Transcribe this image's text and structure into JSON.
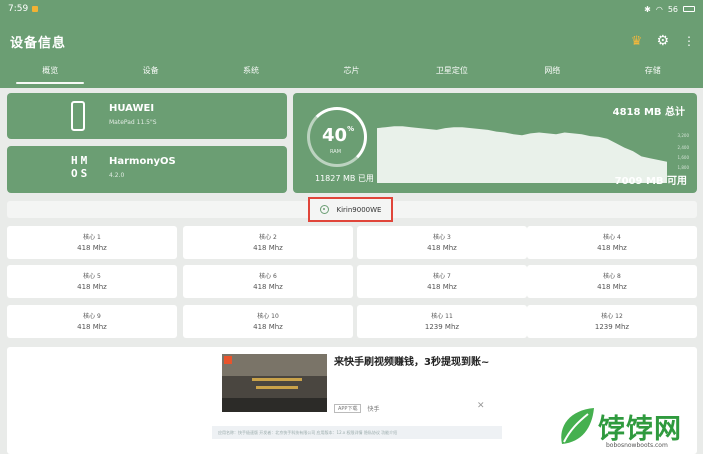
{
  "status_bar": {
    "time": "7:59",
    "right_text": "56"
  },
  "header": {
    "title": "设备信息"
  },
  "tabs": [
    {
      "label": "概览",
      "active": true
    },
    {
      "label": "设备",
      "active": false
    },
    {
      "label": "系统",
      "active": false
    },
    {
      "label": "芯片",
      "active": false
    },
    {
      "label": "卫星定位",
      "active": false
    },
    {
      "label": "网络",
      "active": false
    },
    {
      "label": "存储",
      "active": false
    }
  ],
  "device": {
    "brand": "HUAWEI",
    "model": "MatePad 11.5\"S"
  },
  "os": {
    "logo": "HM OS",
    "name": "HarmonyOS",
    "version": "4.2.0"
  },
  "ram": {
    "percent": "40",
    "percent_unit": "%",
    "label": "RAM",
    "used": "11827 MB 已用",
    "total": "4818 MB 总计",
    "free": "7009 MB 可用",
    "ticks": [
      "3,200",
      "2,400",
      "1,600",
      "1,800"
    ],
    "series": [
      62,
      63,
      64,
      64,
      63,
      62,
      61,
      60,
      62,
      63,
      63,
      62,
      61,
      60,
      58,
      57,
      55,
      54,
      56,
      57,
      56,
      55,
      57,
      56,
      55,
      53,
      52,
      50,
      45,
      40,
      36,
      30,
      28,
      26,
      24
    ]
  },
  "chip": {
    "name": "Kirin9000WE"
  },
  "cores": [
    {
      "name": "核心 1",
      "freq": "418 Mhz"
    },
    {
      "name": "核心 2",
      "freq": "418 Mhz"
    },
    {
      "name": "核心 3",
      "freq": "418 Mhz"
    },
    {
      "name": "核心 4",
      "freq": "418 Mhz"
    },
    {
      "name": "核心 5",
      "freq": "418 Mhz"
    },
    {
      "name": "核心 6",
      "freq": "418 Mhz"
    },
    {
      "name": "核心 7",
      "freq": "418 Mhz"
    },
    {
      "name": "核心 8",
      "freq": "418 Mhz"
    },
    {
      "name": "核心 9",
      "freq": "418 Mhz"
    },
    {
      "name": "核心 10",
      "freq": "418 Mhz"
    },
    {
      "name": "核心 11",
      "freq": "1239 Mhz"
    },
    {
      "name": "核心 12",
      "freq": "1239 Mhz"
    }
  ],
  "ad": {
    "title": "来快手刷视频赚钱，3秒提现到账~",
    "badge": "APP下载",
    "source": "快手",
    "close": "✕",
    "footer": "应用名称：快手极速版  开发者：北京快手科技有限公司  应用版本：12.x  权限详情  隐私协议  功能介绍"
  },
  "watermark": {
    "text": "饽饽网",
    "url": "bobosnowboots.com"
  },
  "colors": {
    "accent": "#6b9e73",
    "highlight": "#e0453a",
    "watermark": "#2f9a3e"
  }
}
